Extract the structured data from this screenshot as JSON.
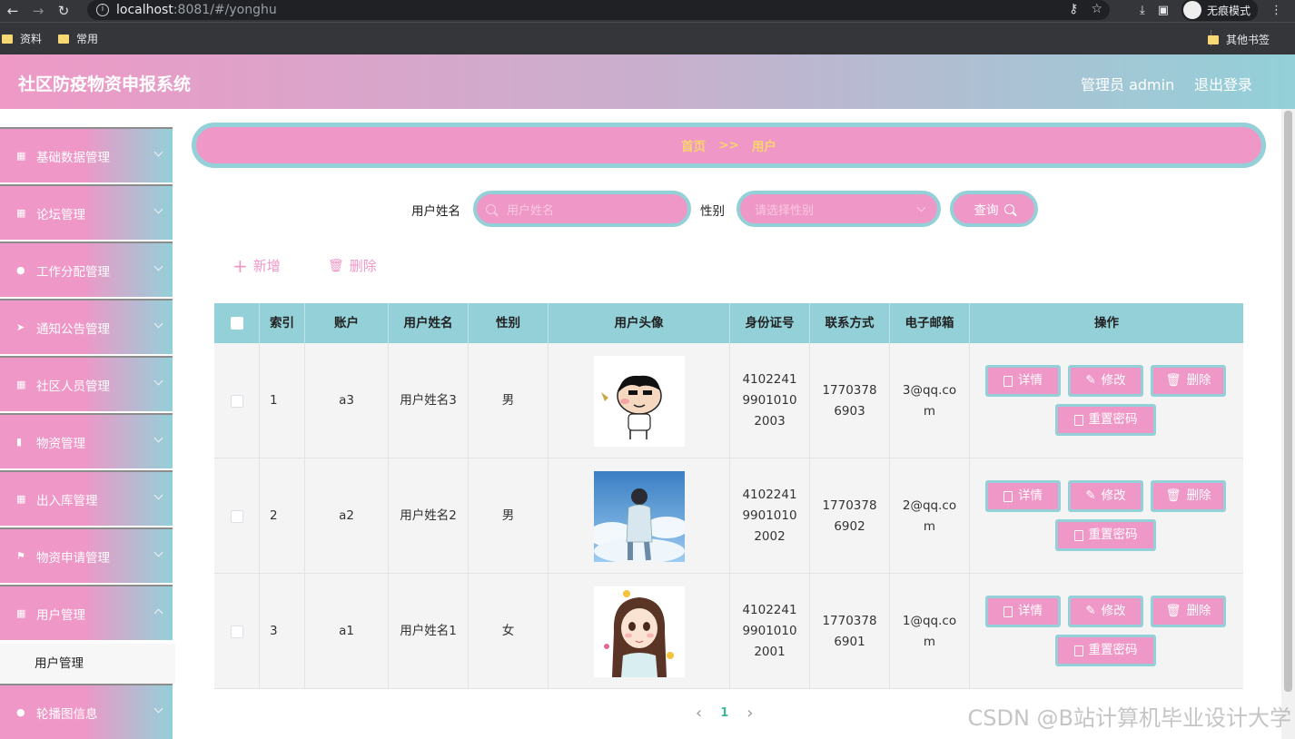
{
  "browser": {
    "url_host": "localhost",
    "url_path": ":8081/#/yonghu",
    "incognito_label": "无痕模式",
    "bookmarks": [
      "资料",
      "常用"
    ],
    "other_bookmarks": "其他书签"
  },
  "header": {
    "title": "社区防疫物资申报系统",
    "user": "管理员 admin",
    "logout": "退出登录"
  },
  "sidebar": {
    "items": [
      {
        "label": "基础数据管理",
        "icon": "grid-icon"
      },
      {
        "label": "论坛管理",
        "icon": "grid-icon"
      },
      {
        "label": "工作分配管理",
        "icon": "user-icon"
      },
      {
        "label": "通知公告管理",
        "icon": "send-icon"
      },
      {
        "label": "社区人员管理",
        "icon": "grid-icon"
      },
      {
        "label": "物资管理",
        "icon": "bar-chart-icon"
      },
      {
        "label": "出入库管理",
        "icon": "grid-icon"
      },
      {
        "label": "物资申请管理",
        "icon": "flag-icon"
      },
      {
        "label": "用户管理",
        "icon": "grid-icon"
      },
      {
        "label": "轮播图信息",
        "icon": "user-icon"
      }
    ],
    "active_sub": "用户管理"
  },
  "breadcrumb": {
    "home": "首页",
    "sep": ">>",
    "current": "用户"
  },
  "search": {
    "name_label": "用户姓名",
    "name_placeholder": "用户姓名",
    "gender_label": "性别",
    "gender_placeholder": "请选择性别",
    "query_label": "查询"
  },
  "toolbar": {
    "add_label": "新增",
    "delete_label": "删除"
  },
  "table": {
    "columns": [
      "索引",
      "账户",
      "用户姓名",
      "性别",
      "用户头像",
      "身份证号",
      "联系方式",
      "电子邮箱",
      "操作"
    ],
    "rows": [
      {
        "index": "1",
        "account": "a3",
        "name": "用户姓名3",
        "gender": "男",
        "id_card": "410224199010102003",
        "phone": "17703786903",
        "email": "3@qq.com"
      },
      {
        "index": "2",
        "account": "a2",
        "name": "用户姓名2",
        "gender": "男",
        "id_card": "410224199010102002",
        "phone": "17703786902",
        "email": "2@qq.com"
      },
      {
        "index": "3",
        "account": "a1",
        "name": "用户姓名1",
        "gender": "女",
        "id_card": "410224199010102001",
        "phone": "17703786901",
        "email": "1@qq.com"
      }
    ],
    "actions": {
      "detail": "详情",
      "edit": "修改",
      "delete": "删除",
      "reset": "重置密码"
    }
  },
  "pagination": {
    "current": "1",
    "prev": "‹",
    "next": "›"
  },
  "watermark": "CSDN @B站计算机毕业设计大学",
  "colors": {
    "pink": "#ef97c7",
    "teal": "#93d0d8",
    "gold": "#f7d56b"
  }
}
